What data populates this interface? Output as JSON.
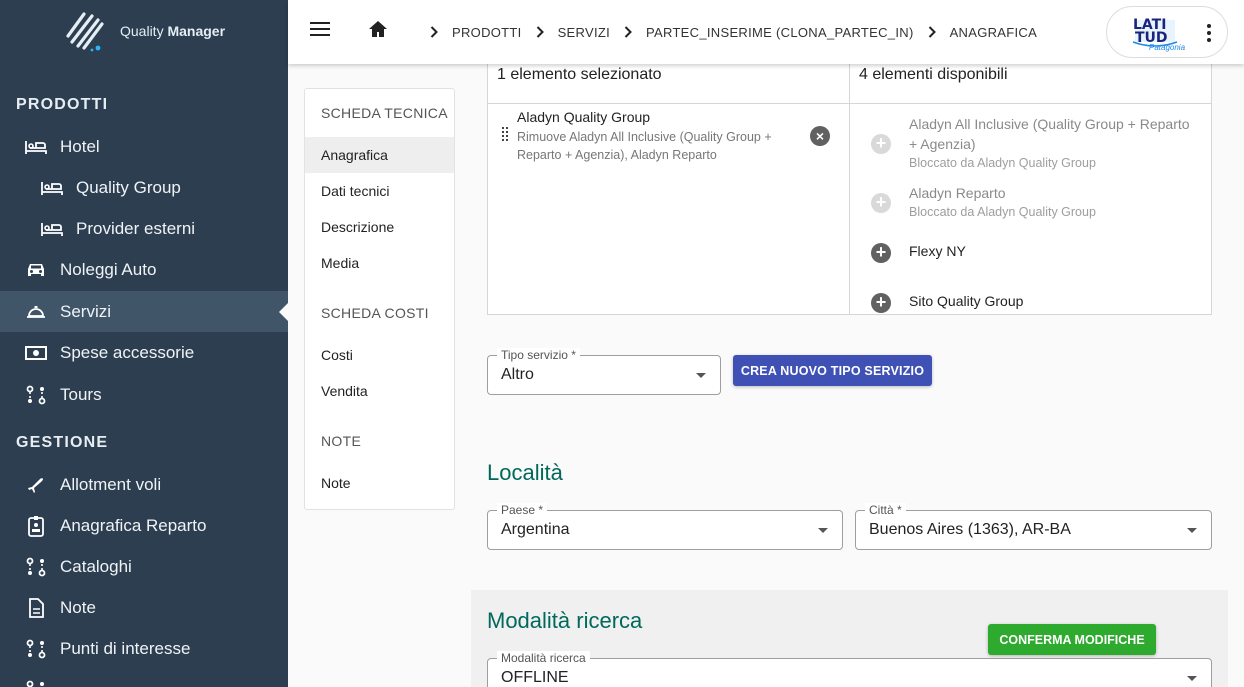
{
  "app": {
    "brand_name_light": "Quality",
    "brand_name_bold": "Manager"
  },
  "sidebar": {
    "sections": [
      {
        "title": "PRODOTTI",
        "items": [
          {
            "label": "Hotel",
            "icon": "bed-icon",
            "level": 0
          },
          {
            "label": "Quality Group",
            "icon": "bed-icon",
            "level": 1
          },
          {
            "label": "Provider esterni",
            "icon": "bed-icon",
            "level": 1
          },
          {
            "label": "Noleggi Auto",
            "icon": "car-icon",
            "level": 0
          },
          {
            "label": "Servizi",
            "icon": "room-service-icon",
            "level": 0,
            "active": true
          },
          {
            "label": "Spese accessorie",
            "icon": "money-icon",
            "level": 0
          },
          {
            "label": "Tours",
            "icon": "route-icon",
            "level": 0
          }
        ]
      },
      {
        "title": "GESTIONE",
        "items": [
          {
            "label": "Allotment voli",
            "icon": "flight-icon",
            "level": 0
          },
          {
            "label": "Anagrafica Reparto",
            "icon": "badge-icon",
            "level": 0
          },
          {
            "label": "Cataloghi",
            "icon": "route-icon",
            "level": 0
          },
          {
            "label": "Note",
            "icon": "document-icon",
            "level": 0
          },
          {
            "label": "Punti di interesse",
            "icon": "route-icon",
            "level": 0
          }
        ]
      }
    ]
  },
  "topbar": {
    "breadcrumbs": [
      "PRODOTTI",
      "SERVIZI",
      "PARTEC_INSERIME (CLONA_PARTEC_IN)",
      "ANAGRAFICA"
    ],
    "partner_logo_text_1": "LATI",
    "partner_logo_text_2": "TUD",
    "partner_logo_sub": "Patagonia"
  },
  "subnav": {
    "groups": [
      {
        "title": "SCHEDA TECNICA",
        "items": [
          {
            "label": "Anagrafica",
            "selected": true
          },
          {
            "label": "Dati tecnici"
          },
          {
            "label": "Descrizione"
          },
          {
            "label": "Media"
          }
        ]
      },
      {
        "title": "SCHEDA COSTI",
        "items": [
          {
            "label": "Costi"
          },
          {
            "label": "Vendita"
          }
        ]
      },
      {
        "title": "NOTE",
        "items": [
          {
            "label": "Note"
          }
        ]
      }
    ]
  },
  "transfer": {
    "selected_header": "1 elemento selezionato",
    "available_header": "4 elementi disponibili",
    "selected": [
      {
        "title": "Aladyn Quality Group",
        "subtitle": "Rimuove Aladyn All Inclusive (Quality Group + Reparto + Agenzia), Aladyn Reparto"
      }
    ],
    "available": [
      {
        "title": "Aladyn All Inclusive (Quality Group + Reparto + Agenzia)",
        "subtitle": "Bloccato da Aladyn Quality Group",
        "disabled": true
      },
      {
        "title": "Aladyn Reparto",
        "subtitle": "Bloccato da Aladyn Quality Group",
        "disabled": true
      },
      {
        "title": "Flexy NY",
        "subtitle": "",
        "disabled": false
      },
      {
        "title": "Sito Quality Group",
        "subtitle": "",
        "disabled": false
      }
    ]
  },
  "tipo_servizio": {
    "label": "Tipo servizio *",
    "value": "Altro"
  },
  "create_button": "CREA NUOVO TIPO SERVIZIO",
  "localita": {
    "heading": "Località",
    "paese": {
      "label": "Paese *",
      "value": "Argentina"
    },
    "citta": {
      "label": "Città *",
      "value": "Buenos Aires (1363), AR-BA"
    }
  },
  "modalita": {
    "heading": "Modalità ricerca",
    "field": {
      "label": "Modalità ricerca",
      "value": "OFFLINE"
    }
  },
  "confirm_button": "CONFERMA MODIFICHE",
  "colors": {
    "sidebar_bg": "#2c3e50",
    "primary": "#3f51b5",
    "success": "#2eaa2e",
    "heading_teal": "#00695c"
  }
}
